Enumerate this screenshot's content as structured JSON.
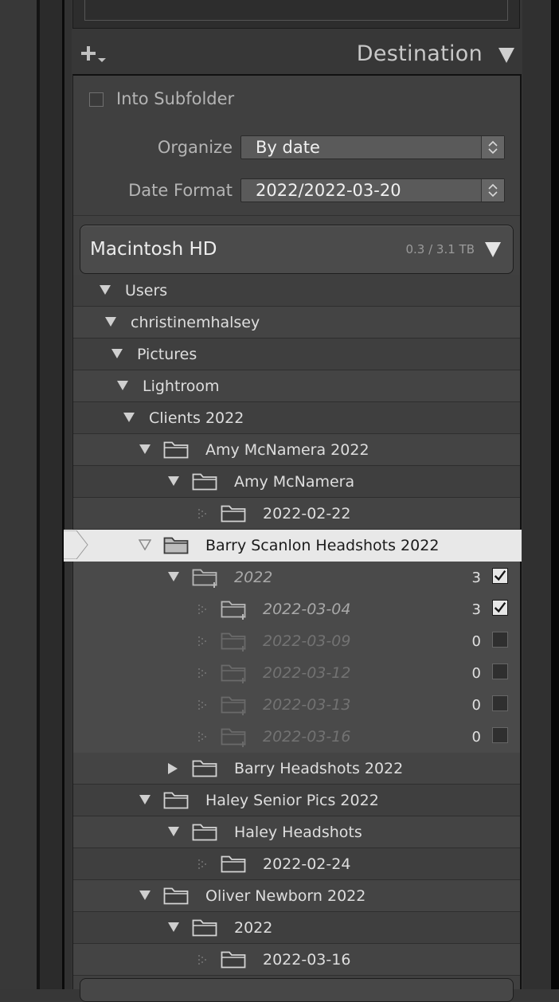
{
  "destination": {
    "title": "Destination",
    "into_subfolder_label": "Into Subfolder",
    "organize_label": "Organize",
    "organize_value": "By date",
    "date_format_label": "Date Format",
    "date_format_value": "2022/2022-03-20"
  },
  "volume": {
    "name": "Macintosh HD",
    "size": "0.3 / 3.1 TB"
  },
  "tree": [
    {
      "label": "Users",
      "state": "expanded",
      "folder": false,
      "new": false
    },
    {
      "label": "christinemhalsey",
      "state": "expanded",
      "folder": false,
      "new": false
    },
    {
      "label": "Pictures",
      "state": "expanded",
      "folder": false,
      "new": false
    },
    {
      "label": "Lightroom",
      "state": "expanded",
      "folder": false,
      "new": false
    },
    {
      "label": "Clients 2022",
      "state": "expanded",
      "folder": false,
      "new": false
    },
    {
      "label": "Amy McNamera 2022",
      "state": "expanded",
      "folder": true,
      "new": false
    },
    {
      "label": "Amy McNamera",
      "state": "expanded",
      "folder": true,
      "new": false
    },
    {
      "label": "2022-02-22",
      "state": "leaf",
      "folder": true,
      "new": false
    },
    {
      "label": "Barry Scanlon Headshots 2022",
      "state": "expanded",
      "folder": true,
      "new": false,
      "selected": true
    },
    {
      "label": "2022",
      "state": "expanded",
      "folder": true,
      "new": true,
      "count": "3",
      "checked": true
    },
    {
      "label": "2022-03-04",
      "state": "leaf",
      "folder": true,
      "new": true,
      "count": "3",
      "checked": true
    },
    {
      "label": "2022-03-09",
      "state": "leaf",
      "folder": true,
      "new": true,
      "count": "0",
      "checked": false
    },
    {
      "label": "2022-03-12",
      "state": "leaf",
      "folder": true,
      "new": true,
      "count": "0",
      "checked": false
    },
    {
      "label": "2022-03-13",
      "state": "leaf",
      "folder": true,
      "new": true,
      "count": "0",
      "checked": false
    },
    {
      "label": "2022-03-16",
      "state": "leaf",
      "folder": true,
      "new": true,
      "count": "0",
      "checked": false
    },
    {
      "label": "Barry Headshots 2022",
      "state": "collapsed",
      "folder": true,
      "new": false
    },
    {
      "label": "Haley Senior Pics 2022",
      "state": "expanded",
      "folder": true,
      "new": false
    },
    {
      "label": "Haley Headshots",
      "state": "expanded",
      "folder": true,
      "new": false
    },
    {
      "label": "2022-02-24",
      "state": "leaf",
      "folder": true,
      "new": false
    },
    {
      "label": "Oliver Newborn 2022",
      "state": "expanded",
      "folder": true,
      "new": false
    },
    {
      "label": "2022",
      "state": "expanded",
      "folder": true,
      "new": false
    },
    {
      "label": "2022-03-16",
      "state": "leaf",
      "folder": true,
      "new": false
    }
  ],
  "icons": {
    "add_destination": "plus-icon",
    "panel_toggle": "triangle-down-icon",
    "folder": "folder-icon",
    "new_folder": "folder-plus-icon",
    "checkbox": "checkbox-icon"
  },
  "colors": {
    "panel_bg": "#404040",
    "selected_row": "#e8e8e8",
    "text": "#dedede",
    "new_folder_text": "#9a9a9a"
  }
}
